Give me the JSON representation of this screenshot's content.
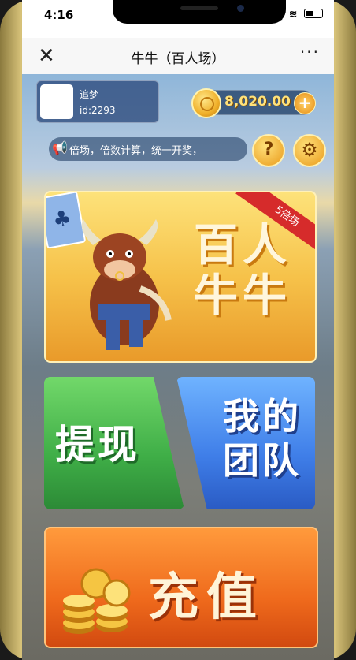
{
  "status_bar": {
    "time": "4:16",
    "icons": "▂▄▆ ≋"
  },
  "nav": {
    "close_glyph": "✕",
    "title": "牛牛（百人场）",
    "more_glyph": "···"
  },
  "user": {
    "name": "追梦",
    "id": "id:2293"
  },
  "wallet": {
    "balance": "8,020.00",
    "plus_glyph": "+"
  },
  "notice": {
    "text": "倍场，倍数计算，统一开奖，"
  },
  "buttons": {
    "help_glyph": "?",
    "settings_glyph": "⚙",
    "banner_badge": "5倍场",
    "banner_title": "百人 牛牛",
    "withdraw": "提现",
    "team": "我的 团队",
    "recharge": "充值"
  },
  "colors": {
    "accent_gold": "#f6c24a",
    "withdraw_green": "#3fae47",
    "team_blue": "#3f7ee8",
    "recharge_orange": "#ef6a1c"
  }
}
